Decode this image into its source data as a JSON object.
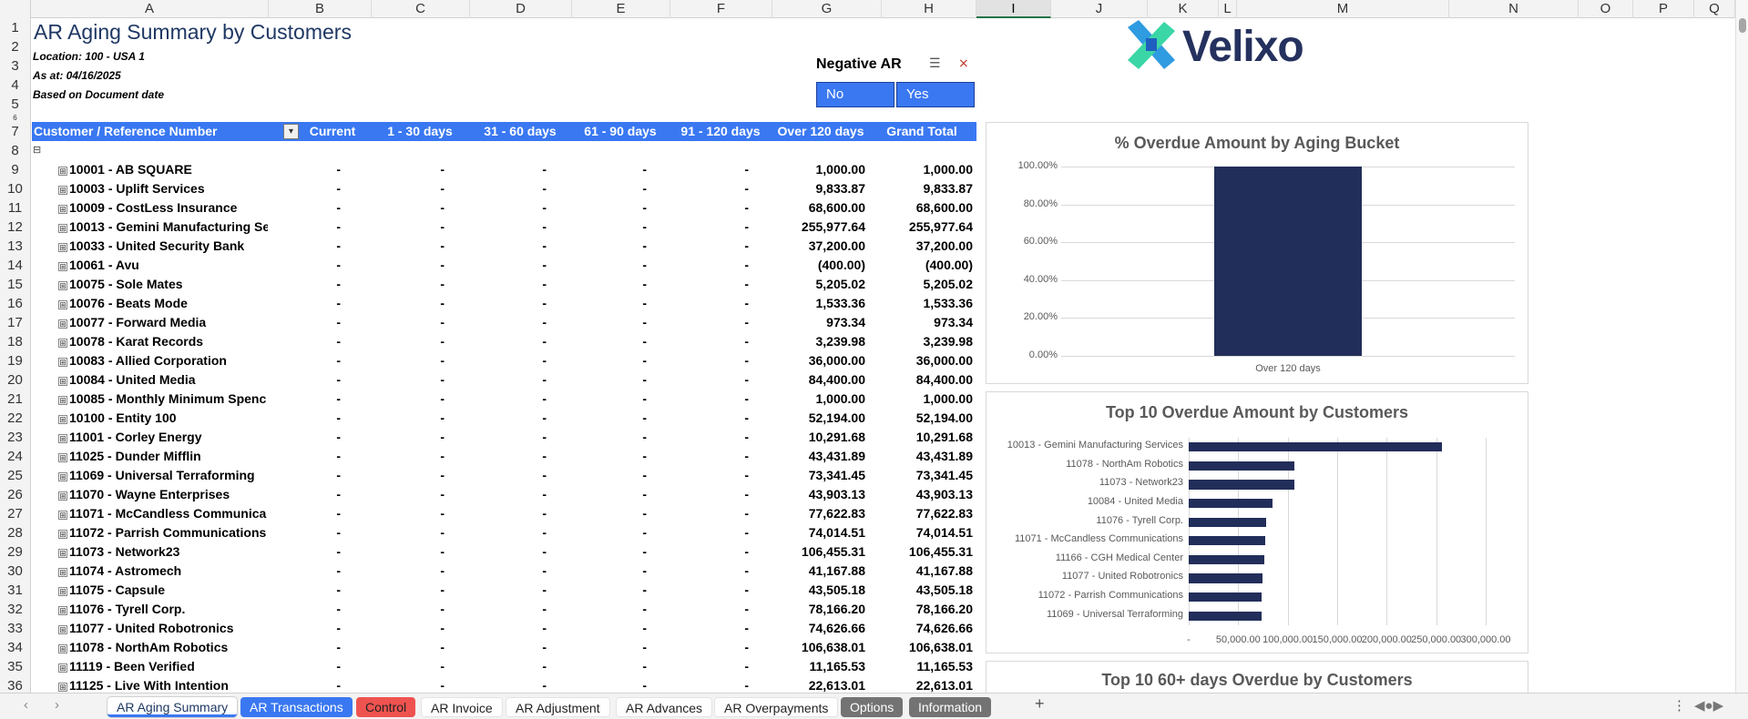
{
  "columns": [
    "A",
    "B",
    "C",
    "D",
    "E",
    "F",
    "G",
    "H",
    "I",
    "J",
    "K",
    "L",
    "M",
    "N",
    "O",
    "P",
    "Q"
  ],
  "row_numbers": [
    "1",
    "2",
    "3",
    "4",
    "5",
    "6",
    "7",
    "8",
    "9",
    "10",
    "11",
    "12",
    "13",
    "14",
    "15",
    "16",
    "17",
    "18",
    "19",
    "20",
    "21",
    "22",
    "23",
    "24",
    "25",
    "26",
    "27",
    "28",
    "29",
    "30",
    "31",
    "32",
    "33",
    "34",
    "35",
    "36"
  ],
  "report": {
    "title": "AR Aging Summary by Customers",
    "location": "Location: 100 - USA 1",
    "as_at": "As at: 04/16/2025",
    "basis": "Based on Document date"
  },
  "slicer": {
    "title": "Negative AR",
    "options": [
      "No",
      "Yes"
    ]
  },
  "logo": {
    "text": "Velixo"
  },
  "table": {
    "headers": [
      "Customer / Reference Number",
      "Current",
      "1 - 30 days",
      "31 - 60 days",
      "61 - 90 days",
      "91 - 120 days",
      "Over 120 days",
      "Grand Total"
    ],
    "collapse_symbol": "⊟",
    "expand_symbol": "⊞",
    "empty_value": "-",
    "rows": [
      {
        "name": "10001 - AB SQUARE",
        "over120": "1,000.00",
        "total": "1,000.00"
      },
      {
        "name": "10003 - Uplift Services",
        "over120": "9,833.87",
        "total": "9,833.87"
      },
      {
        "name": "10009 - CostLess Insurance",
        "over120": "68,600.00",
        "total": "68,600.00"
      },
      {
        "name": "10013 - Gemini Manufacturing Se",
        "over120": "255,977.64",
        "total": "255,977.64"
      },
      {
        "name": "10033 - United Security Bank",
        "over120": "37,200.00",
        "total": "37,200.00"
      },
      {
        "name": "10061 - Avu",
        "over120": "(400.00)",
        "total": "(400.00)"
      },
      {
        "name": "10075 - Sole Mates",
        "over120": "5,205.02",
        "total": "5,205.02"
      },
      {
        "name": "10076 - Beats Mode",
        "over120": "1,533.36",
        "total": "1,533.36"
      },
      {
        "name": "10077 - Forward Media",
        "over120": "973.34",
        "total": "973.34"
      },
      {
        "name": "10078 - Karat Records",
        "over120": "3,239.98",
        "total": "3,239.98"
      },
      {
        "name": "10083 - Allied Corporation",
        "over120": "36,000.00",
        "total": "36,000.00"
      },
      {
        "name": "10084 - United Media",
        "over120": "84,400.00",
        "total": "84,400.00"
      },
      {
        "name": "10085 - Monthly Minimum Spenc",
        "over120": "1,000.00",
        "total": "1,000.00"
      },
      {
        "name": "10100 - Entity 100",
        "over120": "52,194.00",
        "total": "52,194.00"
      },
      {
        "name": "11001 - Corley Energy",
        "over120": "10,291.68",
        "total": "10,291.68"
      },
      {
        "name": "11025 - Dunder Mifflin",
        "over120": "43,431.89",
        "total": "43,431.89"
      },
      {
        "name": "11069 - Universal Terraforming",
        "over120": "73,341.45",
        "total": "73,341.45"
      },
      {
        "name": "11070 - Wayne Enterprises",
        "over120": "43,903.13",
        "total": "43,903.13"
      },
      {
        "name": "11071 - McCandless Communica",
        "over120": "77,622.83",
        "total": "77,622.83"
      },
      {
        "name": "11072 - Parrish Communications",
        "over120": "74,014.51",
        "total": "74,014.51"
      },
      {
        "name": "11073 - Network23",
        "over120": "106,455.31",
        "total": "106,455.31"
      },
      {
        "name": "11074 - Astromech",
        "over120": "41,167.88",
        "total": "41,167.88"
      },
      {
        "name": "11075 - Capsule",
        "over120": "43,505.18",
        "total": "43,505.18"
      },
      {
        "name": "11076 - Tyrell Corp.",
        "over120": "78,166.20",
        "total": "78,166.20"
      },
      {
        "name": "11077 - United Robotronics",
        "over120": "74,626.66",
        "total": "74,626.66"
      },
      {
        "name": "11078 - NorthAm Robotics",
        "over120": "106,638.01",
        "total": "106,638.01"
      },
      {
        "name": "11119 - Been Verified",
        "over120": "11,165.53",
        "total": "11,165.53"
      },
      {
        "name": "11125 - Live With Intention",
        "over120": "22,613.01",
        "total": "22,613.01"
      }
    ]
  },
  "chart_data": [
    {
      "type": "bar",
      "title": "% Overdue Amount by Aging Bucket",
      "categories": [
        "Over 120 days"
      ],
      "values": [
        100
      ],
      "ylim": [
        0,
        100
      ],
      "yticks": [
        "0.00%",
        "20.00%",
        "40.00%",
        "60.00%",
        "80.00%",
        "100.00%"
      ],
      "grid": true,
      "color": "#222e5a"
    },
    {
      "type": "bar",
      "orientation": "horizontal",
      "title": "Top 10 Overdue Amount by Customers",
      "categories": [
        "10013 - Gemini Manufacturing Services",
        "11078 - NorthAm Robotics",
        "11073 - Network23",
        "10084 - United Media",
        "11076 - Tyrell Corp.",
        "11071 - McCandless Communications",
        "11166 - CGH Medical Center",
        "11077 - United Robotronics",
        "11072 - Parrish Communications",
        "11069 - Universal Terraforming"
      ],
      "values": [
        255977.64,
        106638.01,
        106455.31,
        84400.0,
        78166.2,
        77622.83,
        76500,
        74626.66,
        74014.51,
        73341.45
      ],
      "xlim": [
        0,
        300000
      ],
      "xticks": [
        "-",
        "50,000.00",
        "100,000.00",
        "150,000.00",
        "200,000.00",
        "250,000.00",
        "300,000.00"
      ],
      "grid": true,
      "color": "#222e5a"
    },
    {
      "type": "bar",
      "title": "Top 10 60+ days Overdue by Customers"
    }
  ],
  "tabs": [
    {
      "label": "AR Aging Summary",
      "active": true,
      "bg": "#ffffff",
      "color": "#1f3864"
    },
    {
      "label": "AR Transactions",
      "active": false,
      "bg": "#3a78f2",
      "color": "#ffffff"
    },
    {
      "label": "Control",
      "active": false,
      "bg": "#ef5350",
      "color": "#222222"
    },
    {
      "label": "AR Invoice",
      "active": false,
      "bg": "#ffffff",
      "color": "#222222"
    },
    {
      "label": "AR Adjustment",
      "active": false,
      "bg": "#ffffff",
      "color": "#222222"
    },
    {
      "label": "AR Advances",
      "active": false,
      "bg": "#ffffff",
      "color": "#222222"
    },
    {
      "label": "AR Overpayments",
      "active": false,
      "bg": "#ffffff",
      "color": "#222222"
    },
    {
      "label": "Options",
      "active": false,
      "bg": "#737373",
      "color": "#ffffff"
    },
    {
      "label": "Information",
      "active": false,
      "bg": "#737373",
      "color": "#ffffff"
    }
  ],
  "tab_controls": {
    "prev": "‹",
    "next": "›",
    "add": "+",
    "more": "⋮"
  }
}
